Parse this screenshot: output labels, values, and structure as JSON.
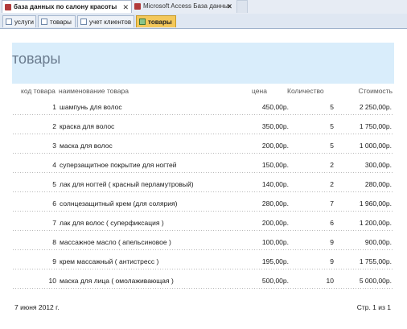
{
  "window_tabs": [
    {
      "label": "база данных по салону красоты",
      "active": true
    },
    {
      "label": "Microsoft Access База данных",
      "active": false
    }
  ],
  "object_tabs": [
    {
      "label": "услуги"
    },
    {
      "label": "товары"
    },
    {
      "label": "учет клиентов"
    },
    {
      "label": "товары",
      "active": true
    }
  ],
  "report": {
    "title": "товары",
    "columns": {
      "code": "код товара",
      "name": "наименование товара",
      "price": "цена",
      "qty": "Количество",
      "cost": "Стоимость"
    },
    "rows": [
      {
        "code": "1",
        "name": "шампунь для волос",
        "price": "450,00р.",
        "qty": "5",
        "cost": "2 250,00р."
      },
      {
        "code": "2",
        "name": "краска для волос",
        "price": "350,00р.",
        "qty": "5",
        "cost": "1 750,00р."
      },
      {
        "code": "3",
        "name": "маска для волос",
        "price": "200,00р.",
        "qty": "5",
        "cost": "1 000,00р."
      },
      {
        "code": "4",
        "name": "суперзащитное покрытие для ногтей",
        "price": "150,00р.",
        "qty": "2",
        "cost": "300,00р."
      },
      {
        "code": "5",
        "name": "лак для ногтей ( красный перламутровый)",
        "price": "140,00р.",
        "qty": "2",
        "cost": "280,00р."
      },
      {
        "code": "6",
        "name": "солнцезащитный крем (для солярия)",
        "price": "280,00р.",
        "qty": "7",
        "cost": "1 960,00р."
      },
      {
        "code": "7",
        "name": "лак для волос ( суперфиксация )",
        "price": "200,00р.",
        "qty": "6",
        "cost": "1 200,00р."
      },
      {
        "code": "8",
        "name": "массажное масло ( апельсиновое )",
        "price": "100,00р.",
        "qty": "9",
        "cost": "900,00р."
      },
      {
        "code": "9",
        "name": "крем массажный ( антистресс )",
        "price": "195,00р.",
        "qty": "9",
        "cost": "1 755,00р."
      },
      {
        "code": "10",
        "name": "маска для лица ( омолаживающая )",
        "price": "500,00р.",
        "qty": "10",
        "cost": "5 000,00р."
      }
    ],
    "footer_date": "7 июня 2012 г.",
    "footer_page": "Стр. 1 из 1"
  }
}
